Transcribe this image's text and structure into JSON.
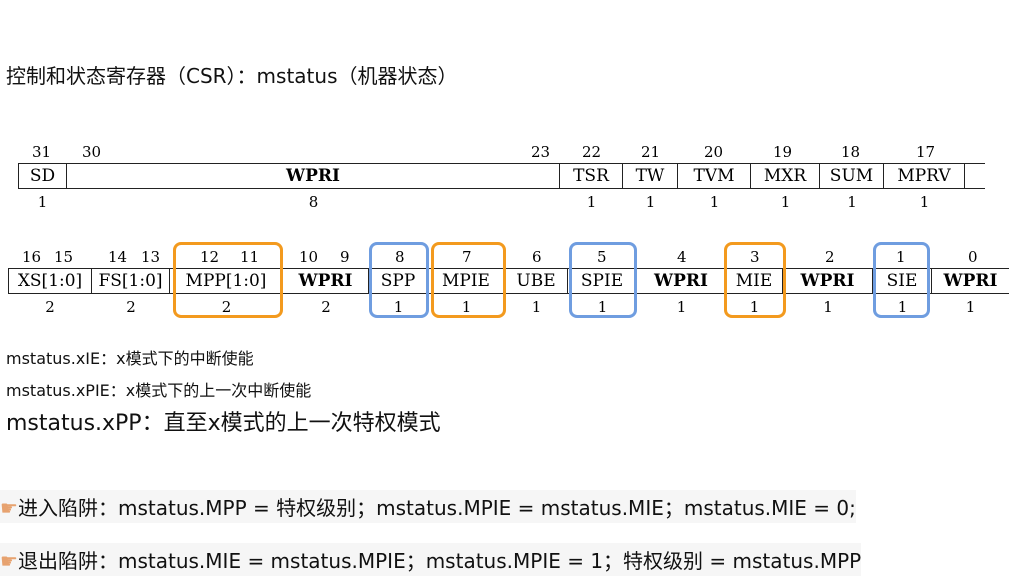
{
  "title": "控制和状态寄存器（CSR）：mstatus（机器状态）",
  "reg_top": {
    "bit_numbers": [
      "31",
      "30",
      "23",
      "22",
      "21",
      "20",
      "19",
      "18",
      "17"
    ],
    "fields": [
      {
        "label": "SD",
        "bold": false
      },
      {
        "label": "WPRI",
        "bold": true
      },
      {
        "label": "TSR",
        "bold": false
      },
      {
        "label": "TW",
        "bold": false
      },
      {
        "label": "TVM",
        "bold": false
      },
      {
        "label": "MXR",
        "bold": false
      },
      {
        "label": "SUM",
        "bold": false
      },
      {
        "label": "MPRV",
        "bold": false
      }
    ],
    "widths": [
      "1",
      "8",
      "1",
      "1",
      "1",
      "1",
      "1",
      "1"
    ]
  },
  "reg_bottom": {
    "bit_numbers": [
      "16",
      "15",
      "14",
      "13",
      "12",
      "11",
      "10",
      "9",
      "8",
      "7",
      "6",
      "5",
      "4",
      "3",
      "2",
      "1",
      "0"
    ],
    "fields": [
      {
        "label": "XS[1:0]",
        "bold": false
      },
      {
        "label": "FS[1:0]",
        "bold": false
      },
      {
        "label": "MPP[1:0]",
        "bold": false
      },
      {
        "label": "WPRI",
        "bold": true
      },
      {
        "label": "SPP",
        "bold": false
      },
      {
        "label": "MPIE",
        "bold": false
      },
      {
        "label": "UBE",
        "bold": false
      },
      {
        "label": "SPIE",
        "bold": false
      },
      {
        "label": "WPRI",
        "bold": true
      },
      {
        "label": "MIE",
        "bold": false
      },
      {
        "label": "WPRI",
        "bold": true
      },
      {
        "label": "SIE",
        "bold": false
      },
      {
        "label": "WPRI",
        "bold": true
      }
    ],
    "widths": [
      "2",
      "2",
      "2",
      "2",
      "1",
      "1",
      "1",
      "1",
      "1",
      "1",
      "1",
      "1",
      "1"
    ]
  },
  "highlight_colors": {
    "orange": "#f39a1e",
    "blue": "#6f9de0"
  },
  "notes": {
    "xie": "mstatus.xIE：x模式下的中断使能",
    "xpie": "mstatus.xPIE：x模式下的上一次中断使能",
    "xpp": "mstatus.xPP：直至x模式的上一次特权模式"
  },
  "trap": {
    "hand_icon": "hand-pointing-icon",
    "enter": "进入陷阱：mstatus.MPP = 特权级别；mstatus.MPIE = mstatus.MIE；mstatus.MIE = 0;",
    "exit": "退出陷阱：mstatus.MIE = mstatus.MPIE；mstatus.MPIE = 1；特权级别 = mstatus.MPP"
  }
}
